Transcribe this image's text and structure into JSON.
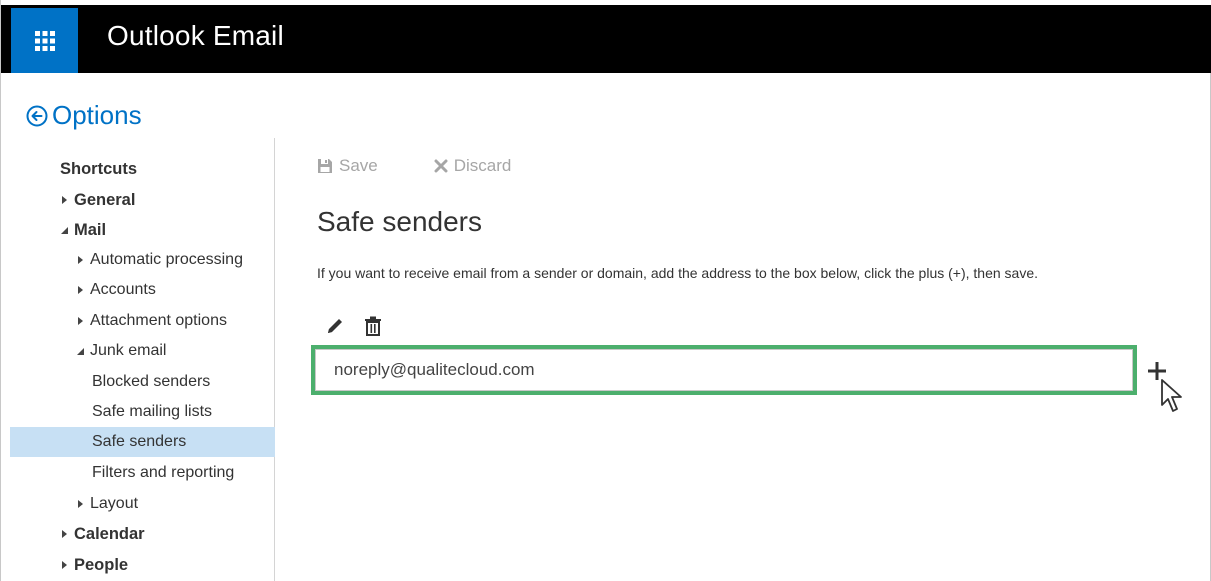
{
  "app": {
    "title": "Outlook Email"
  },
  "options": {
    "label": "Options"
  },
  "sidebar": {
    "items": [
      {
        "label": "Shortcuts"
      },
      {
        "label": "General"
      },
      {
        "label": "Mail"
      },
      {
        "label": "Automatic processing"
      },
      {
        "label": "Accounts"
      },
      {
        "label": "Attachment options"
      },
      {
        "label": "Junk email"
      },
      {
        "label": "Blocked senders"
      },
      {
        "label": "Safe mailing lists"
      },
      {
        "label": "Safe senders"
      },
      {
        "label": "Filters and reporting"
      },
      {
        "label": "Layout"
      },
      {
        "label": "Calendar"
      },
      {
        "label": "People"
      }
    ]
  },
  "toolbar": {
    "save_label": "Save",
    "discard_label": "Discard"
  },
  "main": {
    "title": "Safe senders",
    "instructions": "If you want to receive email from a sender or domain, add the address to the box below, click the plus (+), then save.",
    "input_value": "noreply@qualitecloud.com"
  },
  "icons": {
    "waffle": "app-launcher-icon",
    "back": "back-arrow-icon",
    "save": "save-icon",
    "discard": "discard-x-icon",
    "edit": "pencil-icon",
    "delete": "trash-icon",
    "add": "plus-icon",
    "cursor": "mouse-pointer-icon"
  },
  "colors": {
    "accent": "#0072c6",
    "selected": "#c7e0f4",
    "highlight": "#4caf6d",
    "topbar": "#000000"
  }
}
